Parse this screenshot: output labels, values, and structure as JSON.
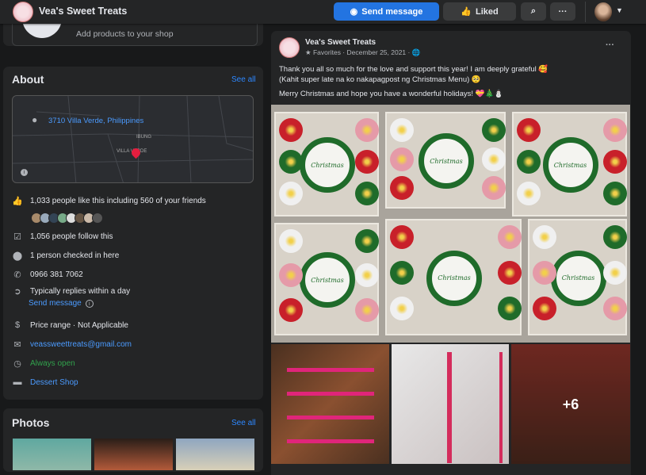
{
  "topbar": {
    "page_name": "Vea's Sweet Treats",
    "send_message": "Send message",
    "liked": "Liked",
    "more": "···"
  },
  "shop": {
    "subtitle": "Add products to your shop"
  },
  "about": {
    "title": "About",
    "see_all": "See all",
    "map": {
      "address": "3710 Villa Verde, Philippines",
      "label_ibung": "IBUNG",
      "label_villa": "VILLA VERDE"
    },
    "likes": "1,033 people like this including 560 of your friends",
    "follows": "1,056 people follow this",
    "checkins": "1 person checked in here",
    "phone": "0966 381 7062",
    "replies": "Typically replies within a day",
    "send_message": "Send message",
    "price": "Price range · Not Applicable",
    "email": "veassweettreats@gmail.com",
    "hours": "Always open",
    "category": "Dessert Shop"
  },
  "photos": {
    "title": "Photos",
    "see_all": "See all"
  },
  "post": {
    "author": "Vea's Sweet Treats",
    "meta": "Favorites · December 25, 2021 ·",
    "line1": "Thank you all so much for the love and support this year! I am deeply grateful 🥰",
    "line2": "(Kahit super late na ko nakapagpost ng Christmas Menu) 🥺",
    "line3": "Merry Christmas and hope you have a wonderful holidays! 💝🎄⛄",
    "more_photos": "+6",
    "cake_text": "Christmas"
  },
  "colors": {
    "accent": "#2374e1",
    "link": "#4b9bff",
    "green": "#31a24c"
  }
}
